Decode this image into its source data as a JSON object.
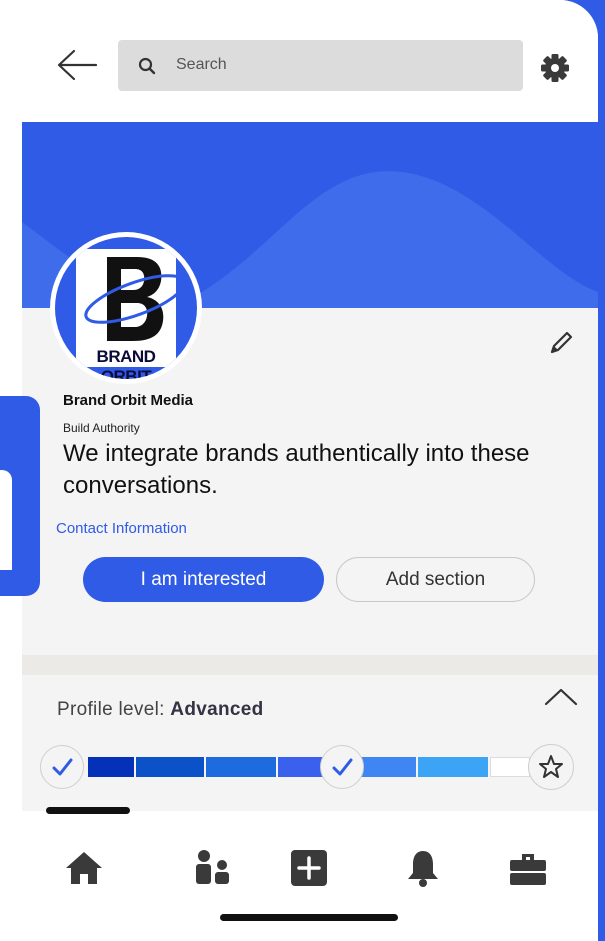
{
  "header": {
    "search_placeholder": "Search"
  },
  "profile": {
    "logo_text": "BRAND ORBIT",
    "name": "Brand Orbit Media",
    "tagline": "Build Authority",
    "about": "We integrate brands authentically into these conversations.",
    "contact_link": "Contact Information",
    "primary_button": "I am interested",
    "secondary_button": "Add section"
  },
  "profile_level": {
    "label": "Profile level:",
    "level": "Advanced",
    "progress_steps_completed": 2,
    "progress_steps_total": 3
  },
  "bottom_nav": {
    "items": [
      "home-icon",
      "network-icon",
      "post-icon",
      "notifications-icon",
      "jobs-icon"
    ]
  },
  "colors": {
    "accent": "#2F5BE6",
    "progress": [
      "#0431B8",
      "#0B52C9",
      "#1E6BE0",
      "#3A60EE",
      "#3F86F2",
      "#3BA4F5",
      "#FFFFFF"
    ]
  }
}
